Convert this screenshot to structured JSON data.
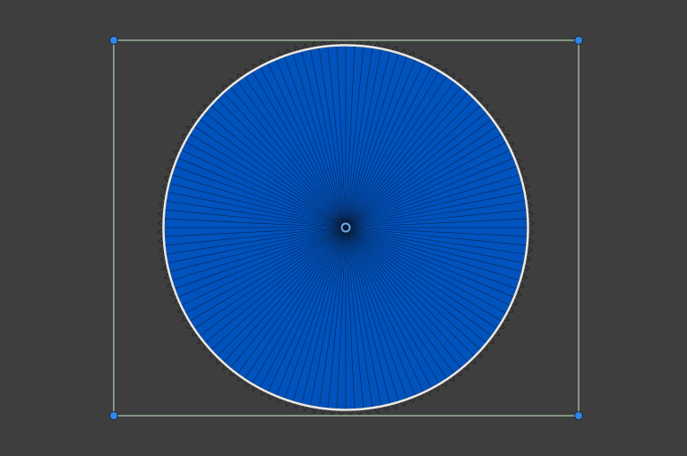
{
  "scene": {
    "background": "#3e3e3e",
    "mesh_fill": "#0052bd",
    "wire_color": "#0a1a33",
    "rect_color": "#c8ecc8",
    "handle_color": "#2f86e8",
    "ring_color": "#e8e8e8",
    "segments": 128
  }
}
